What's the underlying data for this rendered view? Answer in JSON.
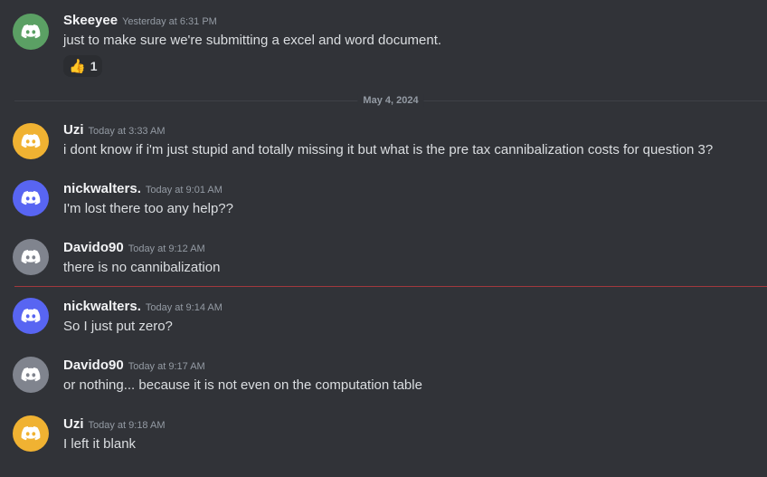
{
  "divider": {
    "date": "May 4, 2024"
  },
  "colors": {
    "background": "#313338",
    "new_message_line": "#a1383e",
    "avatar_green": "#5ba064",
    "avatar_yellow": "#f0b232",
    "avatar_blurple": "#5865f2",
    "avatar_gray": "#80848e"
  },
  "messages": [
    {
      "username": "Skeeyee",
      "timestamp": "Yesterday at 6:31 PM",
      "content": "just to make sure we're submitting a excel and word document.",
      "avatar_icon": "discord-logo-icon",
      "reaction": {
        "emoji": "👍",
        "count": "1"
      }
    },
    {
      "username": "Uzi",
      "timestamp": "Today at 3:33 AM",
      "content": "i dont know if i'm just stupid and totally missing it but what is the pre tax cannibalization costs for question 3?",
      "avatar_icon": "discord-logo-icon"
    },
    {
      "username": "nickwalters.",
      "timestamp": "Today at 9:01 AM",
      "content": "I'm lost there too any help??",
      "avatar_icon": "discord-logo-icon"
    },
    {
      "username": "Davido90",
      "timestamp": "Today at 9:12 AM",
      "content": "there is no cannibalization",
      "avatar_icon": "discord-logo-icon"
    },
    {
      "username": "nickwalters.",
      "timestamp": "Today at 9:14 AM",
      "content": "So I just put zero?",
      "avatar_icon": "discord-logo-icon"
    },
    {
      "username": "Davido90",
      "timestamp": "Today at 9:17 AM",
      "content": "or nothing... because it is not even on the computation table",
      "avatar_icon": "discord-logo-icon"
    },
    {
      "username": "Uzi",
      "timestamp": "Today at 9:18 AM",
      "content": "I left it blank",
      "avatar_icon": "discord-logo-icon"
    }
  ]
}
